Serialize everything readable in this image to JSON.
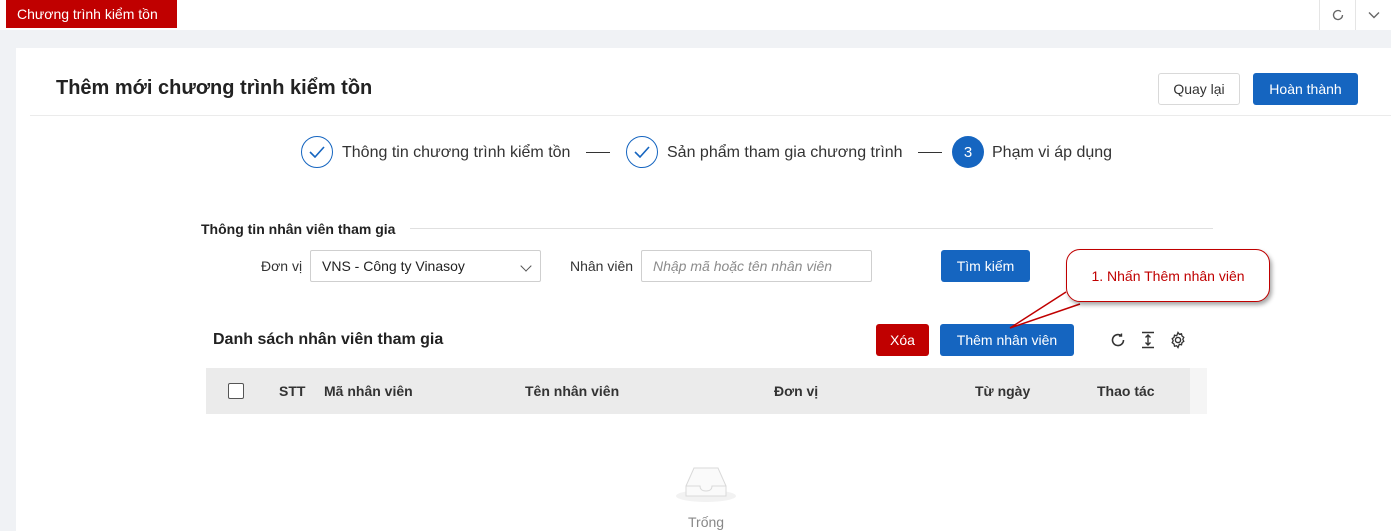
{
  "tabbar": {
    "active_tab": "Chương trình kiểm tồn",
    "refresh_icon": "refresh-icon",
    "collapse_icon": "chevron-down-icon"
  },
  "header": {
    "title": "Thêm mới chương trình kiểm tồn",
    "back_label": "Quay lại",
    "finish_label": "Hoàn thành"
  },
  "steps": [
    {
      "label": "Thông tin chương trình kiểm tồn",
      "status": "done"
    },
    {
      "label": "Sản phẩm tham gia chương trình",
      "status": "done"
    },
    {
      "label": "Phạm vi áp dụng",
      "status": "active",
      "number": "3"
    }
  ],
  "filter": {
    "section_title": "Thông tin nhân viên tham gia",
    "unit_label": "Đơn vị",
    "unit_value": "VNS - Công ty Vinasoy",
    "employee_label": "Nhân viên",
    "employee_placeholder": "Nhập mã hoặc tên nhân viên",
    "search_label": "Tìm kiếm"
  },
  "list": {
    "title": "Danh sách nhân viên tham gia",
    "delete_label": "Xóa",
    "add_label": "Thêm nhân viên",
    "columns": [
      "STT",
      "Mã nhân viên",
      "Tên nhân viên",
      "Đơn vị",
      "Từ ngày",
      "Thao tác"
    ],
    "rows": [],
    "empty_text": "Trống"
  },
  "annotation": {
    "callout_text": "1. Nhấn Thêm nhân viên"
  },
  "colors": {
    "brand_red": "#c00000",
    "primary_blue": "#1565c0"
  }
}
